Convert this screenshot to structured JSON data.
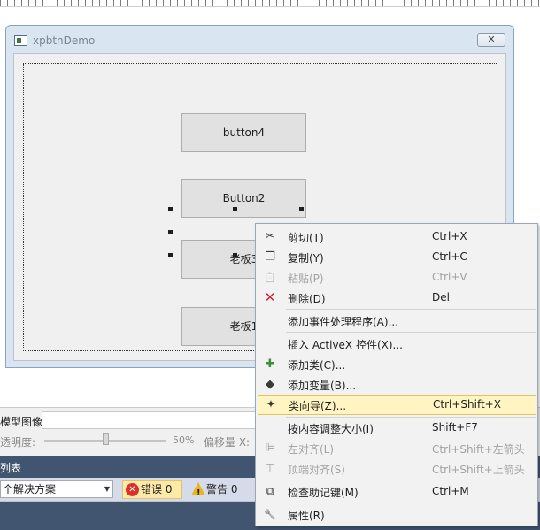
{
  "window": {
    "title": "xpbtnDemo",
    "close_label": "✕"
  },
  "form_controls": {
    "button4": "button4",
    "button2": "Button2",
    "boss3": "老板3",
    "boss1": "老板1"
  },
  "properties": {
    "image_label": "模型图像:",
    "opacity_label": "透明度:",
    "opacity_value": "50%",
    "offset_label": "偏移量 X:"
  },
  "error_panel": {
    "title": "列表",
    "solution_select": "个解决方案",
    "errors_label": "错误 0",
    "warnings_label": "警告 0"
  },
  "context_menu": {
    "items": [
      {
        "icon": "scissors-icon",
        "glyph": "✂",
        "label": "剪切(T)",
        "shortcut": "Ctrl+X",
        "enabled": true
      },
      {
        "icon": "copy-icon",
        "glyph": "❐",
        "label": "复制(Y)",
        "shortcut": "Ctrl+C",
        "enabled": true
      },
      {
        "icon": "paste-icon",
        "glyph": "📋",
        "label": "粘贴(P)",
        "shortcut": "Ctrl+V",
        "enabled": false
      },
      {
        "icon": "delete-icon",
        "glyph": "✕",
        "label": "删除(D)",
        "shortcut": "Del",
        "enabled": true
      },
      {
        "icon": "",
        "glyph": "",
        "label": "添加事件处理程序(A)...",
        "shortcut": "",
        "enabled": true
      },
      {
        "icon": "",
        "glyph": "",
        "label": "插入 ActiveX 控件(X)...",
        "shortcut": "",
        "enabled": true
      },
      {
        "icon": "add-class-icon",
        "glyph": "✚",
        "label": "添加类(C)...",
        "shortcut": "",
        "enabled": true
      },
      {
        "icon": "add-variable-icon",
        "glyph": "◆",
        "label": "添加变量(B)...",
        "shortcut": "",
        "enabled": true
      },
      {
        "icon": "class-wizard-icon",
        "glyph": "✦",
        "label": "类向导(Z)...",
        "shortcut": "Ctrl+Shift+X",
        "enabled": true
      },
      {
        "icon": "",
        "glyph": "",
        "label": "按内容调整大小(I)",
        "shortcut": "Shift+F7",
        "enabled": true
      },
      {
        "icon": "align-left-icon",
        "glyph": "⊫",
        "label": "左对齐(L)",
        "shortcut": "Ctrl+Shift+左箭头",
        "enabled": false
      },
      {
        "icon": "align-top-icon",
        "glyph": "⊤",
        "label": "顶端对齐(S)",
        "shortcut": "Ctrl+Shift+上箭头",
        "enabled": false
      },
      {
        "icon": "accelerator-icon",
        "glyph": "⧉",
        "label": "检查助记键(M)",
        "shortcut": "Ctrl+M",
        "enabled": true
      },
      {
        "icon": "wrench-icon",
        "glyph": "🔧",
        "label": "属性(R)",
        "shortcut": "",
        "enabled": true
      }
    ]
  },
  "colors": {
    "menu_highlight": "#fff5c2",
    "panel_header": "#425570",
    "delete_red": "#c4262e",
    "add_green": "#3e8c3e"
  }
}
